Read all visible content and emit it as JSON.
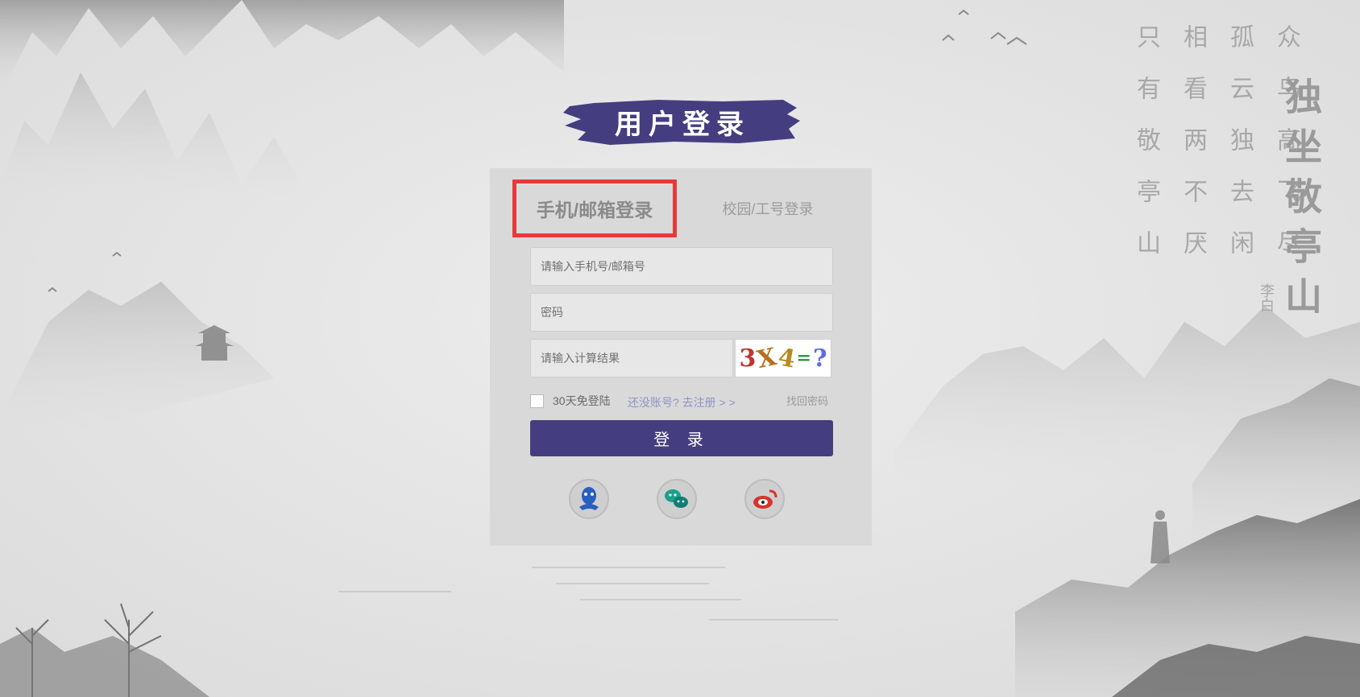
{
  "title": "用户登录",
  "tabs": {
    "phone_email": "手机/邮箱登录",
    "campus": "校园/工号登录"
  },
  "form": {
    "account_placeholder": "请输入手机号/邮箱号",
    "password_placeholder": "密码",
    "captcha_placeholder": "请输入计算结果",
    "captcha_chars": [
      "3",
      "X",
      "4",
      "=",
      "?"
    ],
    "remember_label": "30天免登陆",
    "register_link": "还没账号? 去注册 > >",
    "forgot_link": "找回密码",
    "login_button": "登 录"
  },
  "social": [
    "qq-icon",
    "wechat-icon",
    "weibo-icon"
  ],
  "poem": {
    "title": "独坐敬亭山",
    "author": "李白",
    "columns": [
      "众鸟高飞尽",
      "孤云独去闲",
      "相看两不厌",
      "只有敬亭山"
    ]
  },
  "colors": {
    "accent": "#443e80",
    "highlight": "#e63a3a",
    "panel": "#d9d9d9",
    "link": "#8f94c6"
  }
}
